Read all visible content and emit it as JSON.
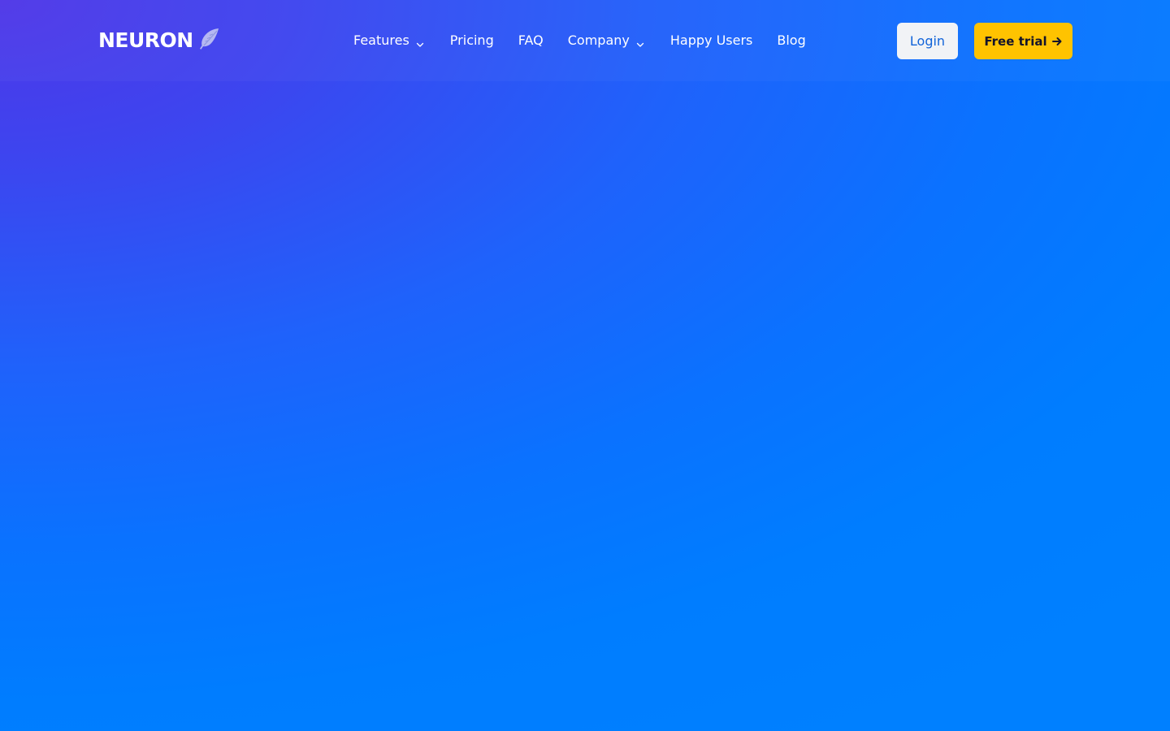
{
  "brand": {
    "name": "NEURON",
    "logo_icon": "feather-icon"
  },
  "nav": {
    "items": [
      {
        "label": "Features",
        "has_dropdown": true,
        "icon": "chevron-down-icon"
      },
      {
        "label": "Pricing",
        "has_dropdown": false
      },
      {
        "label": "FAQ",
        "has_dropdown": false
      },
      {
        "label": "Company",
        "has_dropdown": true,
        "icon": "chevron-down-icon"
      },
      {
        "label": "Happy Users",
        "has_dropdown": false
      },
      {
        "label": "Blog",
        "has_dropdown": false
      }
    ]
  },
  "actions": {
    "login_label": "Login",
    "trial_label": "Free trial",
    "trial_icon": "arrow-right-icon"
  },
  "colors": {
    "gradient_start": "#4f36e8",
    "gradient_end": "#0080ff",
    "login_bg": "#f1f3f6",
    "login_text": "#1063d9",
    "trial_bg": "#ffc300",
    "trial_text": "#14142b",
    "nav_text": "#ffffff"
  }
}
